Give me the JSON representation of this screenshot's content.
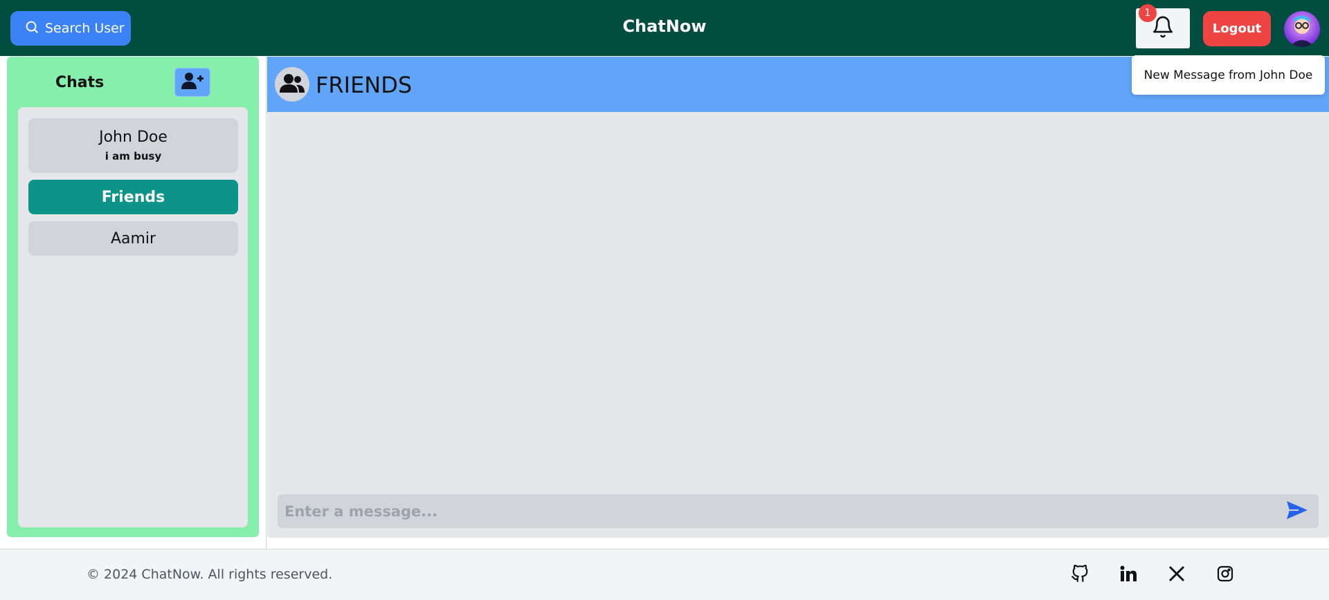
{
  "header": {
    "search_label": "Search User",
    "app_title": "ChatNow",
    "notification_count": "1",
    "logout_label": "Logout"
  },
  "notification": {
    "message": "New Message from John Doe"
  },
  "sidebar": {
    "title": "Chats",
    "chats": [
      {
        "name": "John Doe",
        "last_message": "i am busy"
      },
      {
        "name": "Friends"
      },
      {
        "name": "Aamir"
      }
    ]
  },
  "chat": {
    "title": "FRIENDS",
    "input_placeholder": "Enter a message..."
  },
  "footer": {
    "copyright": "© 2024 ChatNow. All rights reserved."
  },
  "colors": {
    "topbar": "#014d40",
    "accent_blue": "#3b82f6",
    "danger": "#ef4444",
    "sidebar_bg": "#86efac",
    "active_chat": "#0d9488",
    "chat_header": "#60a5fa"
  },
  "icons": [
    "search-icon",
    "bell-icon",
    "user-plus-icon",
    "users-icon",
    "send-icon",
    "github-icon",
    "linkedin-icon",
    "x-icon",
    "instagram-icon"
  ]
}
